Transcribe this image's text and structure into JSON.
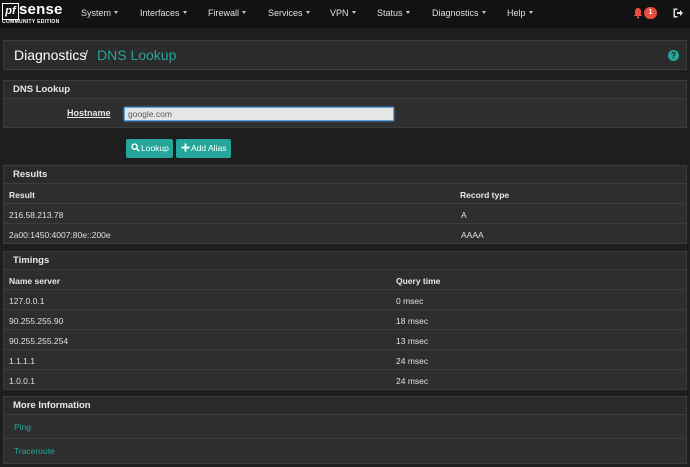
{
  "brand": {
    "logo_pf": "pf",
    "logo_sense": "sense",
    "edition": "COMMUNITY EDITION"
  },
  "nav": {
    "items": [
      "System",
      "Interfaces",
      "Firewall",
      "Services",
      "VPN",
      "Status",
      "Diagnostics",
      "Help"
    ],
    "notification_count": "1"
  },
  "page": {
    "breadcrumb_parent": "Diagnostics",
    "breadcrumb_separator": "/",
    "title": "DNS Lookup",
    "help_glyph": "?"
  },
  "lookup_panel": {
    "heading": "DNS Lookup",
    "hostname_label": "Hostname",
    "hostname_value": "google.com",
    "lookup_button": "Lookup",
    "add_alias_button": "Add Alias"
  },
  "results": {
    "heading": "Results",
    "columns": [
      "Result",
      "Record type"
    ],
    "rows": [
      [
        "216.58.213.78",
        "A"
      ],
      [
        "2a00:1450:4007:80e::200e",
        "AAAA"
      ]
    ]
  },
  "timings": {
    "heading": "Timings",
    "columns": [
      "Name server",
      "Query time"
    ],
    "rows": [
      [
        "127.0.0.1",
        "0 msec"
      ],
      [
        "90.255.255.90",
        "18 msec"
      ],
      [
        "90.255.255.254",
        "13 msec"
      ],
      [
        "1.1.1.1",
        "24 msec"
      ],
      [
        "1.0.0.1",
        "24 msec"
      ]
    ]
  },
  "more_info": {
    "heading": "More Information",
    "links": [
      "Ping",
      "Traceroute"
    ]
  },
  "colors": {
    "accent": "#26a69a",
    "alert": "#e74c3c",
    "navbar": "#121212",
    "background": "#1e1e1e"
  },
  "icons": {
    "bell": "bell-icon",
    "logout": "sign-out-icon",
    "help": "question-circle-icon",
    "lookup": "search-icon",
    "add_alias": "plus-icon"
  }
}
